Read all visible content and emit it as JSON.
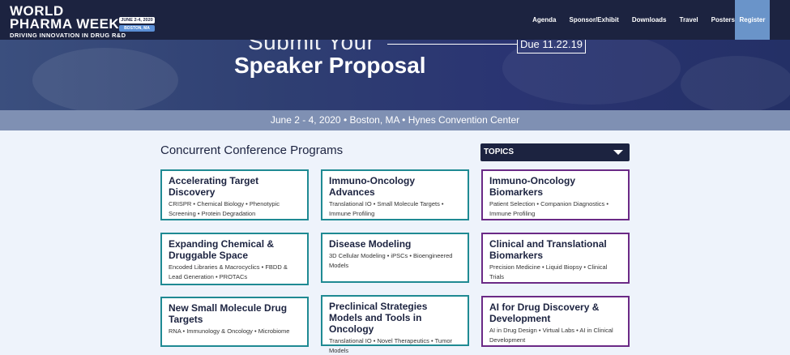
{
  "header": {
    "logo_line1": "WORLD",
    "logo_line2": "PHARMA WEEK",
    "logo_tagline": "DRIVING INNOVATION IN DRUG R&D",
    "badge_dates": "JUNE 2-4, 2020",
    "badge_location": "BOSTON, MA",
    "nav": [
      "Agenda",
      "Sponsor/Exhibit",
      "Downloads",
      "Travel",
      "Posters"
    ],
    "register_label": "Register"
  },
  "hero": {
    "submit_text": "Submit Your",
    "proposal_text": "Speaker Proposal",
    "due_text": "Due 11.22.19",
    "event_info": "June 2 - 4, 2020 • Boston, MA • Hynes Convention Center"
  },
  "programs": {
    "title": "Concurrent Conference Programs",
    "topics_label": "TOPICS",
    "cards": [
      {
        "title": "Accelerating Target Discovery",
        "subtitle": "CRISPR • Chemical Biology • Phenotypic Screening • Protein Degradation"
      },
      {
        "title": "Immuno-Oncology Advances",
        "subtitle": "Translational IO • Small Molecule Targets • Immune Profiling"
      },
      {
        "title": "Immuno-Oncology Biomarkers",
        "subtitle": "Patient Selection • Companion Diagnostics • Immune Profiling"
      },
      {
        "title": "Expanding Chemical & Druggable Space",
        "subtitle": "Encoded Libraries & Macrocyclics • FBDD & Lead Generation • PROTACs"
      },
      {
        "title": "Disease Modeling",
        "subtitle": "3D Cellular Modeling • iPSCs • Bioengineered Models"
      },
      {
        "title": "Clinical and Translational Biomarkers",
        "subtitle": "Precision Medicine • Liquid Biopsy • Clinical Trials"
      },
      {
        "title": "New Small Molecule Drug Targets",
        "subtitle": "RNA • Immunology & Oncology • Microbiome"
      },
      {
        "title": "Preclinical Strategies Models and Tools in Oncology",
        "subtitle": "Translational IO • Novel Therapeutics • Tumor Models"
      },
      {
        "title": "AI for Drug Discovery & Development",
        "subtitle": "AI in Drug Design • Virtual Labs • AI in Clinical Development"
      }
    ]
  },
  "colors": {
    "nav_bg": "#1c2340",
    "teal_border": "#1f8a93",
    "purple_border": "#6b2a86",
    "register_bg": "#6a94c9"
  }
}
